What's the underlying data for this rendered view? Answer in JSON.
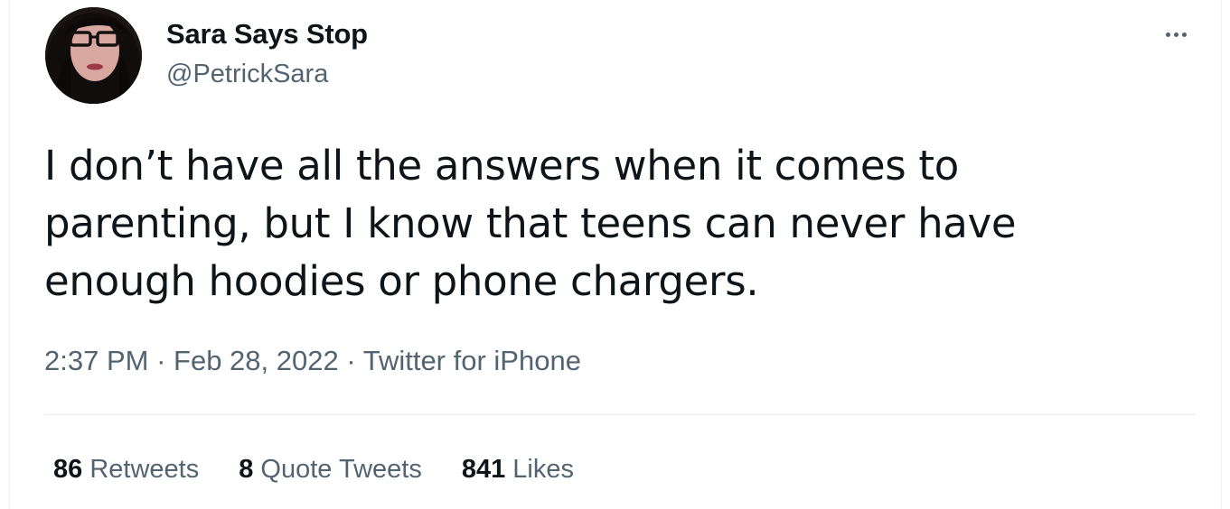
{
  "author": {
    "name": "Sara Says Stop",
    "handle": "@PetrickSara"
  },
  "tweet": {
    "text": "I don’t have all the answers when it comes to\nparenting, but I know that teens can never have\nenough hoodies or phone chargers.",
    "time": "2:37 PM",
    "date": "Feb 28, 2022",
    "source": "Twitter for iPhone",
    "separator": " · "
  },
  "stats": {
    "retweets": {
      "count": "86",
      "label": "Retweets"
    },
    "quote_tweets": {
      "count": "8",
      "label": "Quote Tweets"
    },
    "likes": {
      "count": "841",
      "label": "Likes"
    }
  },
  "icons": {
    "more": "more-horizontal-icon"
  },
  "colors": {
    "text_primary": "#0f1419",
    "text_secondary": "#536471",
    "divider": "#e6ecf0"
  }
}
